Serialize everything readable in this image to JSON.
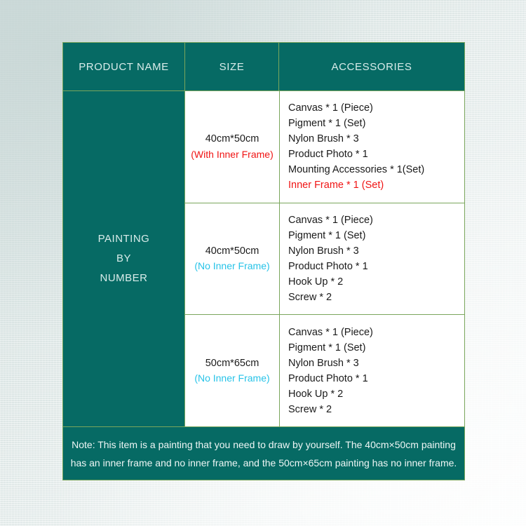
{
  "background": {
    "paper_color": "#e8eeed",
    "texture": "linen-weave"
  },
  "table": {
    "accent_teal": "#066a64",
    "border_color": "#7aa65c",
    "header_text_color": "#d9ecea",
    "red": "#f01414",
    "cyan": "#27c3e8",
    "headers": {
      "product_name": "PRODUCT NAME",
      "size": "SIZE",
      "accessories": "ACCESSORIES"
    },
    "product_name": {
      "line1": "PAINTING",
      "line2": "BY",
      "line3": "NUMBER"
    },
    "rows": [
      {
        "size": "40cm*50cm",
        "frame_note": "(With Inner Frame)",
        "frame_note_color": "red",
        "accessories": [
          {
            "text": "Canvas * 1 (Piece)",
            "color": "black"
          },
          {
            "text": "Pigment * 1 (Set)",
            "color": "black"
          },
          {
            "text": "Nylon Brush * 3",
            "color": "black"
          },
          {
            "text": "Product Photo * 1",
            "color": "black"
          },
          {
            "text": "Mounting Accessories * 1(Set)",
            "color": "black"
          },
          {
            "text": "Inner Frame * 1 (Set)",
            "color": "red"
          }
        ]
      },
      {
        "size": "40cm*50cm",
        "frame_note": "(No Inner Frame)",
        "frame_note_color": "cyan",
        "accessories": [
          {
            "text": "Canvas * 1 (Piece)",
            "color": "black"
          },
          {
            "text": "Pigment * 1 (Set)",
            "color": "black"
          },
          {
            "text": "Nylon Brush * 3",
            "color": "black"
          },
          {
            "text": "Product Photo * 1",
            "color": "black"
          },
          {
            "text": "Hook Up * 2",
            "color": "black"
          },
          {
            "text": "Screw * 2",
            "color": "black"
          }
        ]
      },
      {
        "size": "50cm*65cm",
        "frame_note": "(No Inner Frame)",
        "frame_note_color": "cyan",
        "accessories": [
          {
            "text": "Canvas * 1 (Piece)",
            "color": "black"
          },
          {
            "text": "Pigment * 1 (Set)",
            "color": "black"
          },
          {
            "text": "Nylon Brush * 3",
            "color": "black"
          },
          {
            "text": "Product Photo * 1",
            "color": "black"
          },
          {
            "text": "Hook Up * 2",
            "color": "black"
          },
          {
            "text": "Screw * 2",
            "color": "black"
          }
        ]
      }
    ],
    "note": {
      "line1": "Note: This item is a painting that you need to draw by yourself. The 40cm×50cm painting",
      "line2": "has an inner frame and no inner frame, and the 50cm×65cm painting has no inner frame."
    }
  }
}
